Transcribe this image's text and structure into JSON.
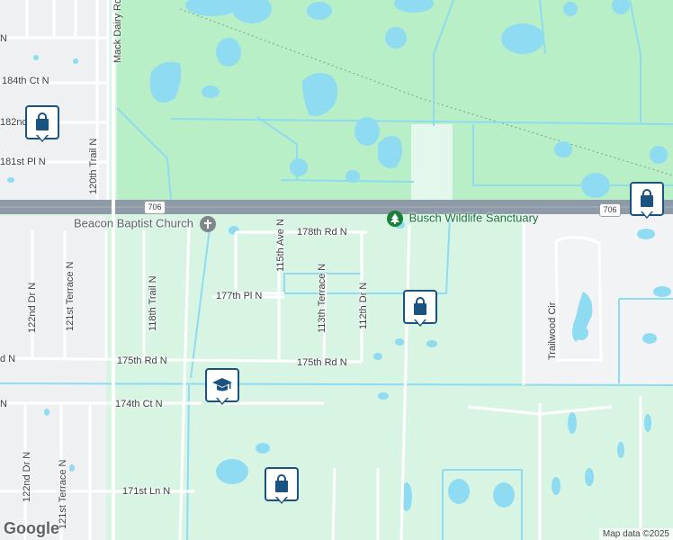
{
  "colors": {
    "land": "#d8f5e4",
    "park": "#b5efc4",
    "water": "#8fdcf2",
    "road": "#ffffff",
    "highway": "#8e9aa8",
    "urban": "#e8ebee",
    "pin_border": "#1a5380"
  },
  "roads": {
    "r184": "184th Ct N",
    "r182": "182nd",
    "r181": "181st Pl N",
    "r178": "178th Rd N",
    "r177": "177th Pl N",
    "r175_left": "175th Rd N",
    "r175_right": "175th Rd N",
    "r175_edge": "d N",
    "r174": "174th Ct N",
    "r171": "171st Ln N",
    "r_top_left": "N",
    "r_edge_174": "N",
    "v_mack": "Mack Dairy Rd",
    "v_120": "120th Trail N",
    "v_122a": "122nd Dr N",
    "v_121a": "121st Terrace N",
    "v_118": "118th Trail N",
    "v_115": "115th Ave N",
    "v_113": "113th Terrace N",
    "v_112": "112th Dr N",
    "v_trailwood": "Trailwood Cir",
    "v_122b": "122nd Dr N",
    "v_121b": "121st Terrace N"
  },
  "highway_shields": [
    "706",
    "706"
  ],
  "pois": {
    "church": "Beacon Baptist Church",
    "park": "Busch Wildlife Sanctuary"
  },
  "markers": [
    {
      "name": "shopping-marker-1",
      "icon": "shopping-bag-icon"
    },
    {
      "name": "shopping-marker-2",
      "icon": "shopping-bag-icon"
    },
    {
      "name": "shopping-marker-3",
      "icon": "shopping-bag-icon"
    },
    {
      "name": "school-marker",
      "icon": "school-icon"
    },
    {
      "name": "shopping-marker-4",
      "icon": "shopping-bag-icon"
    }
  ],
  "logo": "Google",
  "attribution": "Map data ©2025"
}
